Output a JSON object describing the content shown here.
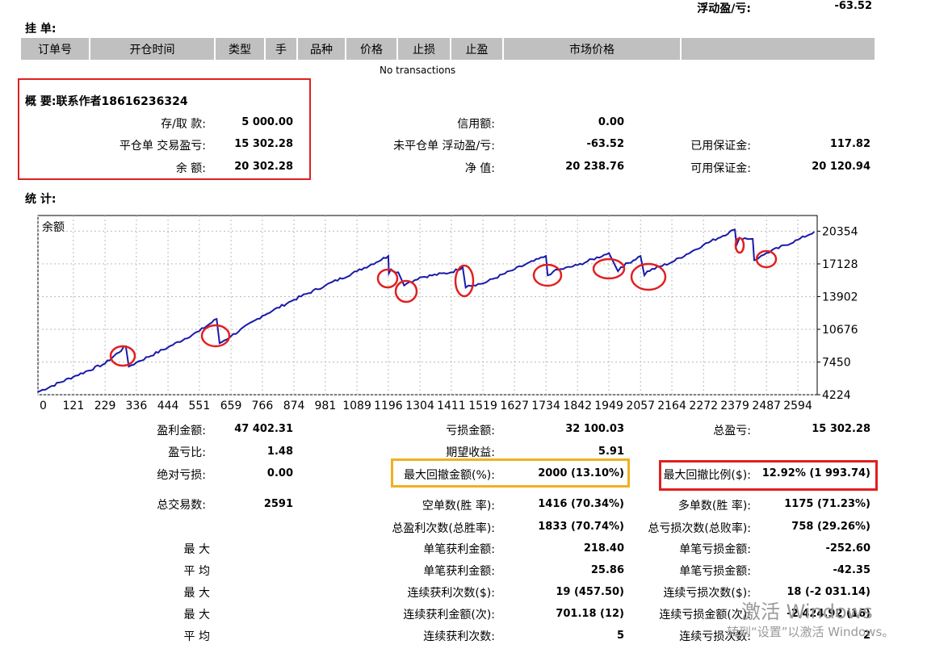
{
  "top": {
    "floating_label": "浮动盈/亏:",
    "floating_value": "-63.52"
  },
  "pending": {
    "title": "挂 单:",
    "columns": [
      "订单号",
      "开仓时间",
      "类型",
      "手",
      "品种",
      "价格",
      "止损",
      "止盈",
      "市场价格",
      ""
    ],
    "empty_text": "No transactions"
  },
  "summary": {
    "title": "概 要:联系作者18616236324",
    "deposit_label": "存/取 款:",
    "deposit_value": "5 000.00",
    "closed_label": "平仓单 交易盈亏:",
    "closed_value": "15 302.28",
    "balance_label": "余 额:",
    "balance_value": "20 302.28",
    "credit_label": "信用额:",
    "credit_value": "0.00",
    "open_label": "未平仓单 浮动盈/亏:",
    "open_value": "-63.52",
    "equity_label": "净 值:",
    "equity_value": "20 238.76",
    "margin_label": "已用保证金:",
    "margin_value": "117.82",
    "free_margin_label": "可用保证金:",
    "free_margin_value": "20 120.94"
  },
  "stats_title": "统 计:",
  "chart_data": {
    "type": "line",
    "title": "余额",
    "series": [
      {
        "x": [
          0,
          121,
          229,
          300,
          310,
          336,
          444,
          551,
          610,
          620,
          659,
          766,
          874,
          981,
          1089,
          1196,
          1198,
          1205,
          1230,
          1250,
          1260,
          1304,
          1411,
          1450,
          1460,
          1470,
          1519,
          1627,
          1734,
          1740,
          1760,
          1842,
          1949,
          1980,
          1990,
          2057,
          2070,
          2080,
          2164,
          2272,
          2379,
          2385,
          2395,
          2440,
          2445,
          2460,
          2487,
          2594,
          2650
        ],
        "values": [
          4500,
          6000,
          7300,
          9000,
          7000,
          7400,
          8900,
          10500,
          11700,
          9300,
          10000,
          12000,
          13600,
          15000,
          16400,
          17900,
          16200,
          16600,
          16300,
          15000,
          15200,
          15800,
          16300,
          16800,
          14800,
          15000,
          15200,
          16600,
          17900,
          16000,
          16400,
          17000,
          18200,
          16400,
          16800,
          17900,
          16000,
          16400,
          17300,
          19000,
          20500,
          19000,
          19700,
          19600,
          17500,
          17700,
          18200,
          19500,
          20300
        ]
      }
    ],
    "xticks": [
      "0",
      "121",
      "229",
      "336",
      "444",
      "551",
      "659",
      "766",
      "874",
      "981",
      "1089",
      "1196",
      "1304",
      "1411",
      "1519",
      "1627",
      "1734",
      "1842",
      "1949",
      "2057",
      "2164",
      "2272",
      "2379",
      "2487",
      "2594"
    ],
    "yticks": [
      "20354",
      "17128",
      "13902",
      "10676",
      "7450",
      "4224"
    ],
    "ylim": [
      4224,
      21900
    ],
    "xlim": [
      0,
      2660
    ],
    "grid": true,
    "line_color": "#1a1aa8"
  },
  "stats": {
    "gross_profit_label": "盈利金额:",
    "gross_profit_value": "47 402.31",
    "gross_loss_label": "亏损金额:",
    "gross_loss_value": "32 100.03",
    "net_label": "总盈亏:",
    "net_value": "15 302.28",
    "pf_label": "盈亏比:",
    "pf_value": "1.48",
    "expected_label": "期望收益:",
    "expected_value": "5.91",
    "abs_dd_label": "绝对亏损:",
    "abs_dd_value": "0.00",
    "max_dd_label": "最大回撤金额(%):",
    "max_dd_value": "2000 (13.10%)",
    "rel_dd_label": "最大回撤比例($):",
    "rel_dd_value": "12.92% (1 993.74)",
    "total_trades_label": "总交易数:",
    "total_trades_value": "2591",
    "short_label": "空单数(胜 率):",
    "short_value": "1416 (70.34%)",
    "long_label": "多单数(胜 率):",
    "long_value": "1175 (71.23%)",
    "win_count_label": "总盈利次数(总胜率):",
    "win_count_value": "1833 (70.74%)",
    "loss_count_label": "总亏损次数(总败率):",
    "loss_count_value": "758 (29.26%)",
    "max_label": "最 大",
    "avg_label": "平 均",
    "max2_label": "最 大",
    "max3_label": "最 大",
    "avg2_label": "平 均",
    "largest_win_label": "单笔获利金额:",
    "largest_win_value": "218.40",
    "largest_loss_label": "单笔亏损金额:",
    "largest_loss_value": "-252.60",
    "avg_win_label": "单笔获利金额:",
    "avg_win_value": "25.86",
    "avg_loss_label": "单笔亏损金额:",
    "avg_loss_value": "-42.35",
    "cons_wins_label": "连续获利次数($):",
    "cons_wins_value": "19 (457.50)",
    "cons_losses_label": "连续亏损次数($):",
    "cons_losses_value": "18 (-2 031.14)",
    "cons_profit_label": "连续获利金额(次):",
    "cons_profit_value": "701.18 (12)",
    "cons_loss_label": "连续亏损金额(次):",
    "cons_loss_value": "-2 424.92 (16)",
    "avg_cons_wins_label": "连续获利次数:",
    "avg_cons_wins_value": "5",
    "avg_cons_losses_label": "连续亏损次数:",
    "avg_cons_losses_value": "2"
  },
  "watermark": {
    "line1": "激活 Windows",
    "line2": "转到“设置”以激活 Windows。"
  },
  "colors": {
    "highlight_red": "#e02020",
    "highlight_orange": "#f0b020",
    "header_gray": "#c0c0c0"
  }
}
